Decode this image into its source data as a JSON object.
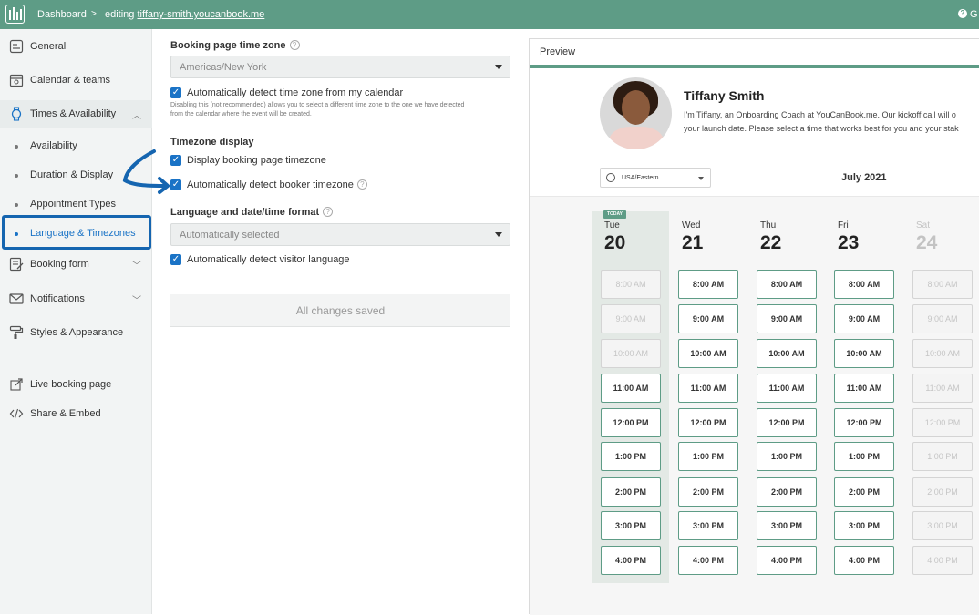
{
  "topbar": {
    "breadcrumb_root": "Dashboard",
    "separator": ">",
    "editing_prefix": "editing",
    "editing_link": "tiffany-smith.youcanbook.me",
    "right_partial": "G"
  },
  "sidebar": {
    "items": [
      {
        "label": "General",
        "icon": "general-icon"
      },
      {
        "label": "Calendar & teams",
        "icon": "calendar-icon"
      },
      {
        "label": "Times & Availability",
        "icon": "watch-icon"
      },
      {
        "label": "Booking form",
        "icon": "form-icon"
      },
      {
        "label": "Notifications",
        "icon": "mail-icon"
      },
      {
        "label": "Styles & Appearance",
        "icon": "paint-roller-icon"
      },
      {
        "label": "Live booking page",
        "icon": "external-link-icon"
      },
      {
        "label": "Share & Embed",
        "icon": "code-icon"
      }
    ],
    "subitems": [
      "Availability",
      "Duration & Display",
      "Appointment Types",
      "Language & Timezones"
    ],
    "active_subitem": "Language & Timezones"
  },
  "settings": {
    "tz_heading": "Booking page time zone",
    "tz_value": "Americas/New York",
    "auto_tz_label": "Automatically detect time zone from my calendar",
    "auto_tz_fine_1": "Disabling this (not recommended) allows you to select a different time zone to the one we have detected",
    "auto_tz_fine_2": "from the calendar where the event will be created.",
    "tz_display_heading": "Timezone display",
    "display_tz_label": "Display booking page timezone",
    "detect_booker_label": "Automatically detect booker timezone",
    "lang_heading": "Language and date/time format",
    "lang_value": "Automatically selected",
    "detect_lang_label": "Automatically detect visitor language",
    "saved_text": "All changes saved"
  },
  "preview": {
    "title": "Preview",
    "name": "Tiffany Smith",
    "desc_line1": "I'm Tiffany, an Onboarding Coach at YouCanBook.me. Our kickoff call will o",
    "desc_line2": "your launch date. Please select a time that works best for you and your stak",
    "tz_select": "USA/Eastern",
    "month": "July 2021",
    "today_tag": "TODAY",
    "days": [
      {
        "name": "Tue",
        "date": "20",
        "disabled_slots": [
          0,
          1,
          2
        ]
      },
      {
        "name": "Wed",
        "date": "21",
        "disabled_slots": []
      },
      {
        "name": "Thu",
        "date": "22",
        "disabled_slots": []
      },
      {
        "name": "Fri",
        "date": "23",
        "disabled_slots": []
      },
      {
        "name": "Sat",
        "date": "24",
        "disabled_slots": [
          0,
          1,
          2,
          3,
          4,
          5,
          6,
          7,
          8
        ]
      }
    ],
    "times": [
      "8:00 AM",
      "9:00 AM",
      "10:00 AM",
      "11:00 AM",
      "12:00 PM",
      "1:00 PM",
      "2:00 PM",
      "3:00 PM",
      "4:00 PM"
    ]
  },
  "colors": {
    "brand": "#5e9c86",
    "accent": "#1a73c6",
    "highlight": "#1565b0"
  }
}
